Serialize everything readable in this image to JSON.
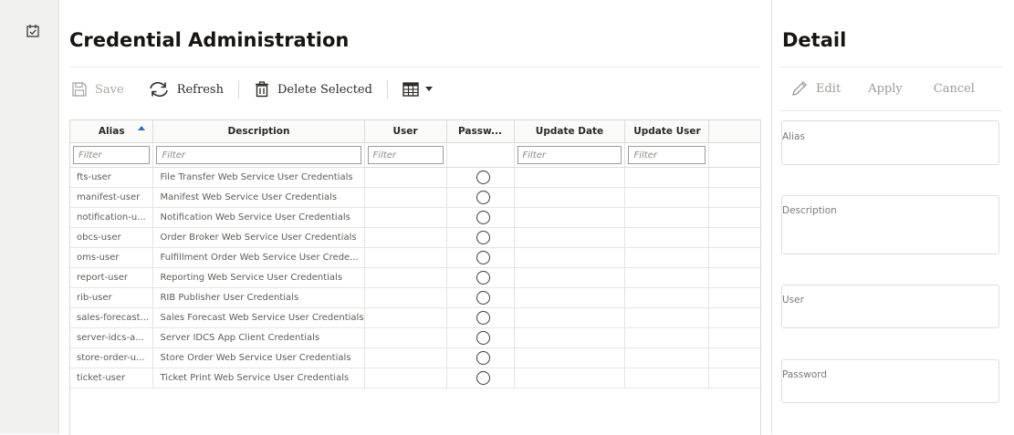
{
  "header": {
    "title": "Credential Administration"
  },
  "toolbar": {
    "save": "Save",
    "refresh": "Refresh",
    "delete_selected": "Delete Selected"
  },
  "grid": {
    "columns": [
      "Alias",
      "Description",
      "User",
      "Passw...",
      "Update Date",
      "Update User"
    ],
    "filter_placeholder": "Filter",
    "rows": [
      {
        "alias": "fts-user",
        "description": "File Transfer Web Service User Credentials"
      },
      {
        "alias": "manifest-user",
        "description": "Manifest Web Service User Credentials"
      },
      {
        "alias": "notification-u...",
        "description": "Notification Web Service User Credentials"
      },
      {
        "alias": "obcs-user",
        "description": "Order Broker Web Service User Credentials"
      },
      {
        "alias": "oms-user",
        "description": "Fulfillment Order Web Service User Crede..."
      },
      {
        "alias": "report-user",
        "description": "Reporting Web Service User Credentials"
      },
      {
        "alias": "rib-user",
        "description": "RIB Publisher User Credentials"
      },
      {
        "alias": "sales-forecast...",
        "description": "Sales Forecast Web Service User Credentials"
      },
      {
        "alias": "server-idcs-a...",
        "description": "Server IDCS App Client Credentials"
      },
      {
        "alias": "store-order-u...",
        "description": "Store Order Web Service User Credentials"
      },
      {
        "alias": "ticket-user",
        "description": "Ticket Print Web Service User Credentials"
      }
    ]
  },
  "detail": {
    "title": "Detail",
    "edit": "Edit",
    "apply": "Apply",
    "cancel": "Cancel",
    "fields": {
      "alias": "Alias",
      "description": "Description",
      "user": "User",
      "password": "Password"
    }
  },
  "colors": {
    "sort_arrow": "#2d6fb5",
    "rail_bg": "#f1f1ef"
  },
  "icons": [
    "task-check-icon",
    "save-icon",
    "refresh-icon",
    "trash-icon",
    "table-icon",
    "dropdown-caret-icon",
    "pencil-icon",
    "radio-icon"
  ]
}
